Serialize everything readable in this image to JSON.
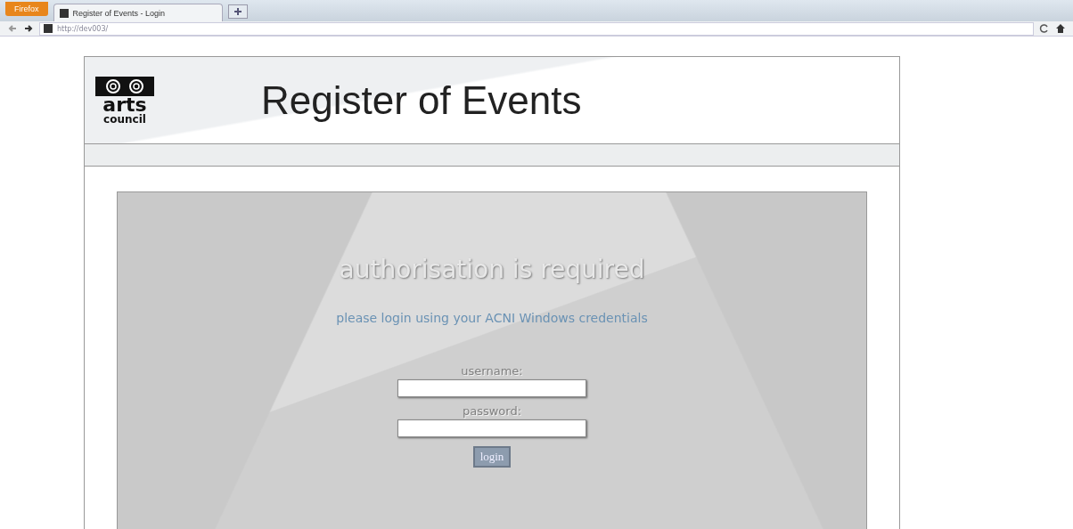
{
  "browser": {
    "menu_button": "Firefox",
    "tabs": [
      {
        "label": "Register of Events - Login",
        "selected": true
      }
    ],
    "address": "http://dev003/"
  },
  "header": {
    "logo": {
      "line_1": "arts",
      "line_2": "council"
    },
    "title": "Register of Events"
  },
  "login": {
    "heading": "authorisation is required",
    "subheading": "please login using your ACNI Windows credentials",
    "fields": [
      {
        "label": "username:"
      },
      {
        "label": "password:"
      }
    ],
    "button": "login"
  }
}
